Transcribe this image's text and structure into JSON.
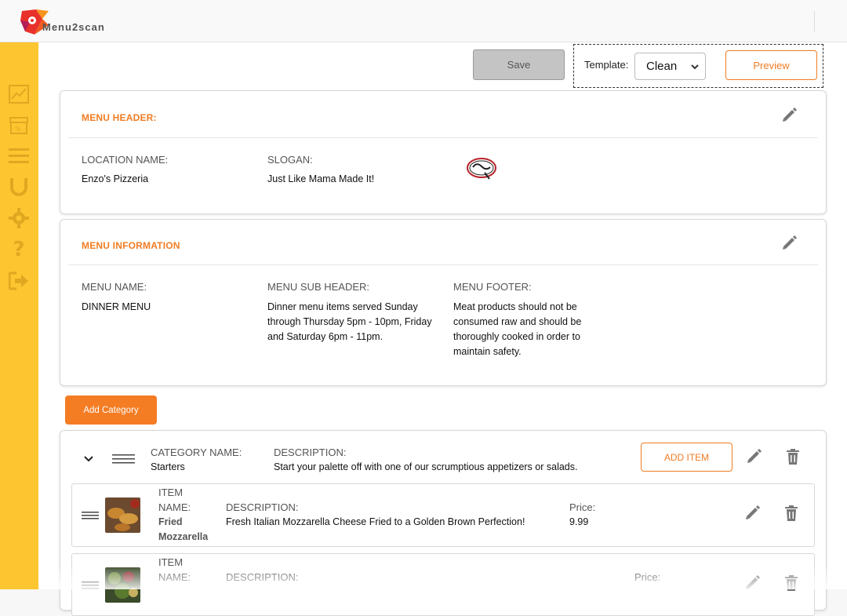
{
  "brand": {
    "name": "Menu2scan"
  },
  "sidebar": {
    "items": [
      {
        "icon": "chart-line-icon"
      },
      {
        "icon": "store-icon"
      },
      {
        "icon": "menu-list-icon"
      },
      {
        "icon": "magnet-icon"
      },
      {
        "icon": "gear-icon"
      },
      {
        "icon": "help-icon"
      },
      {
        "icon": "logout-icon"
      }
    ]
  },
  "toolbar": {
    "save_label": "Save",
    "template_label": "Template:",
    "template_value": "Clean",
    "preview_label": "Preview"
  },
  "menu_header": {
    "title": "MENU HEADER:",
    "location_label": "LOCATION NAME:",
    "location_value": "Enzo's Pizzeria",
    "slogan_label": "SLOGAN:",
    "slogan_value": "Just Like Mama Made It!"
  },
  "menu_info": {
    "title": "MENU INFORMATION",
    "name_label": "MENU NAME:",
    "name_value": "DINNER MENU",
    "subheader_label": "MENU SUB HEADER:",
    "subheader_value": "Dinner menu items served Sunday through Thursday 5pm - 10pm, Friday and Saturday 6pm - 11pm.",
    "footer_label": "MENU FOOTER:",
    "footer_value": "Meat products should not be consumed raw and should be thoroughly cooked in order to maintain safety."
  },
  "add_category_label": "Add Category",
  "category": {
    "name_label": "CATEGORY NAME:",
    "name_value": "Starters",
    "desc_label": "DESCRIPTION:",
    "desc_value": "Start your palette off with one of our scrumptious appetizers or salads.",
    "add_item_label": "ADD ITEM",
    "items": [
      {
        "name_label_1": "ITEM",
        "name_label_2": "NAME:",
        "name_value_1": "Fried",
        "name_value_2": "Mozzarella",
        "desc_label": "DESCRIPTION:",
        "desc_value": "Fresh Italian Mozzarella Cheese Fried to a Golden Brown Perfection!",
        "price_label": "Price:",
        "price_value": "9.99"
      },
      {
        "name_label_1": "ITEM",
        "name_label_2": "NAME:",
        "desc_label": "DESCRIPTION:",
        "price_label": "Price:"
      }
    ]
  },
  "colors": {
    "accent": "#f07c23",
    "sidebar": "#fdc530"
  }
}
